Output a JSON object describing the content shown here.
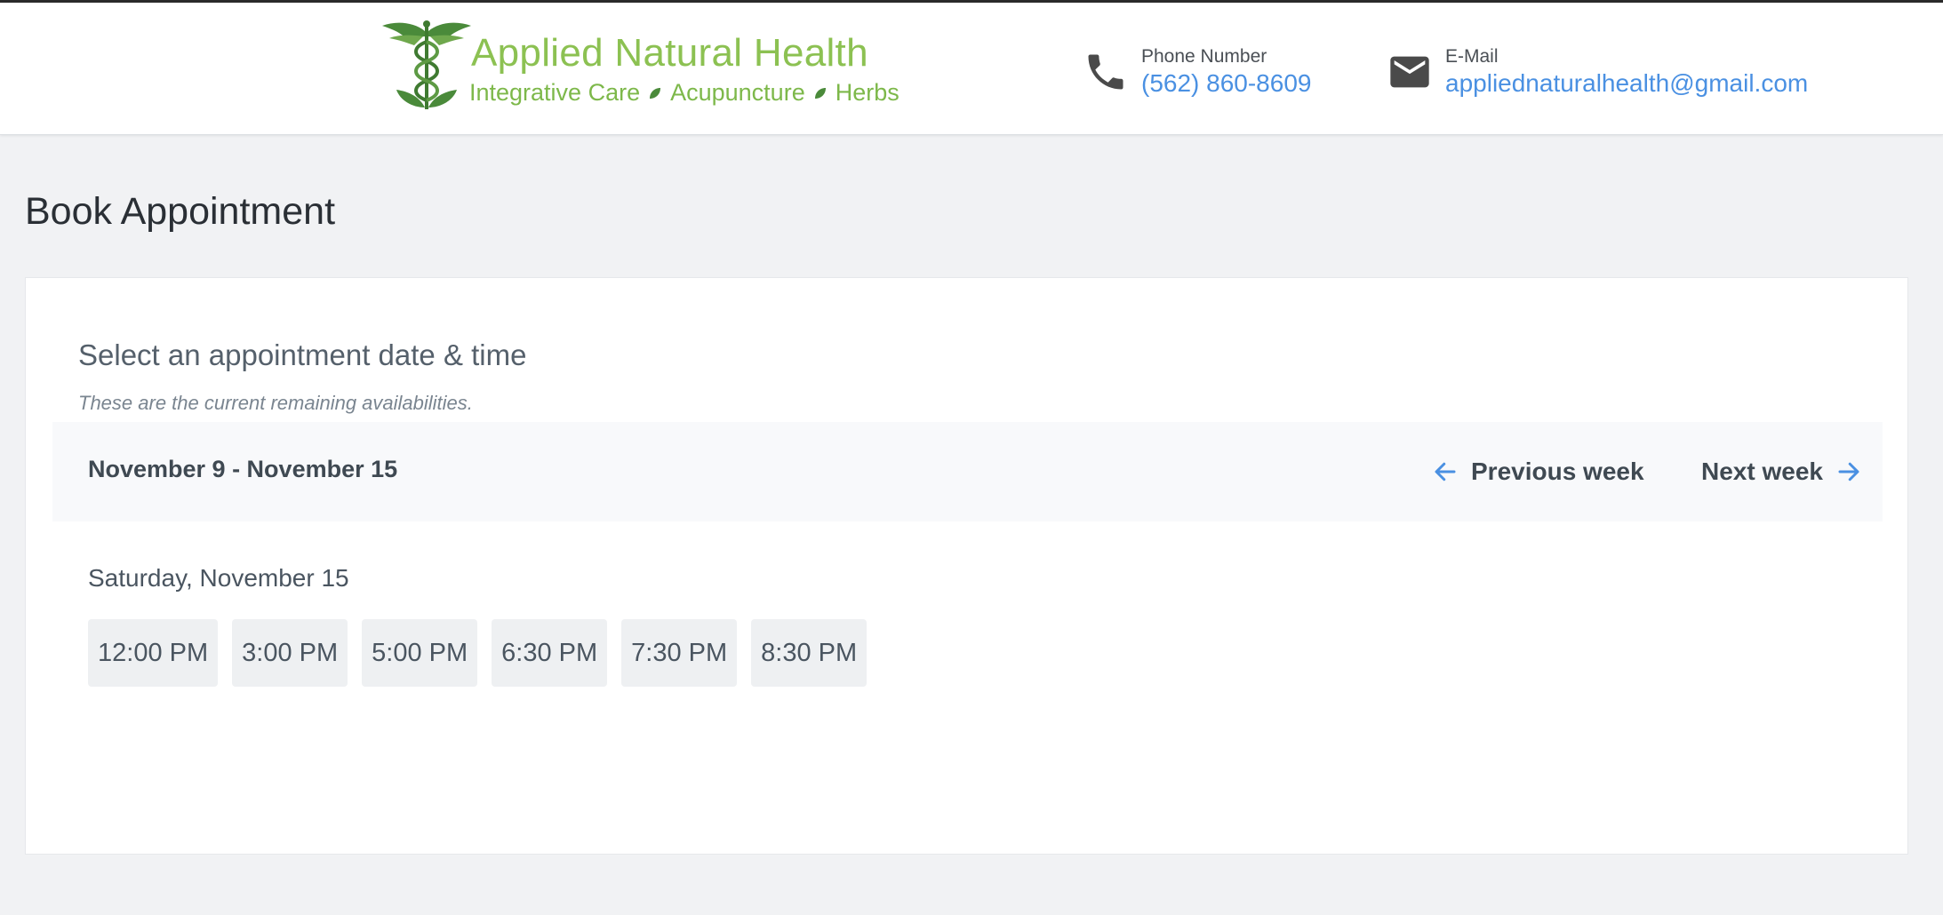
{
  "brand": {
    "name": "Applied Natural Health",
    "tagline": [
      "Integrative Care",
      "Acupuncture",
      "Herbs"
    ],
    "primary_color": "#8cc152",
    "logo_icon": "caduceus-icon"
  },
  "contact": {
    "phone": {
      "label": "Phone Number",
      "value": "(562) 860-8609",
      "icon": "phone-icon"
    },
    "email": {
      "label": "E-Mail",
      "value": "appliednaturalhealth@gmail.com",
      "icon": "mail-icon"
    },
    "link_color": "#4a90e2"
  },
  "page": {
    "title": "Book Appointment"
  },
  "booking": {
    "heading": "Select an appointment date & time",
    "subheading": "These are the current remaining availabilities.",
    "week_range": "November 9 - November 15",
    "prev_label": "Previous week",
    "next_label": "Next week",
    "day": "Saturday, November 15",
    "times": [
      "12:00 PM",
      "3:00 PM",
      "5:00 PM",
      "6:30 PM",
      "7:30 PM",
      "8:30 PM"
    ]
  }
}
